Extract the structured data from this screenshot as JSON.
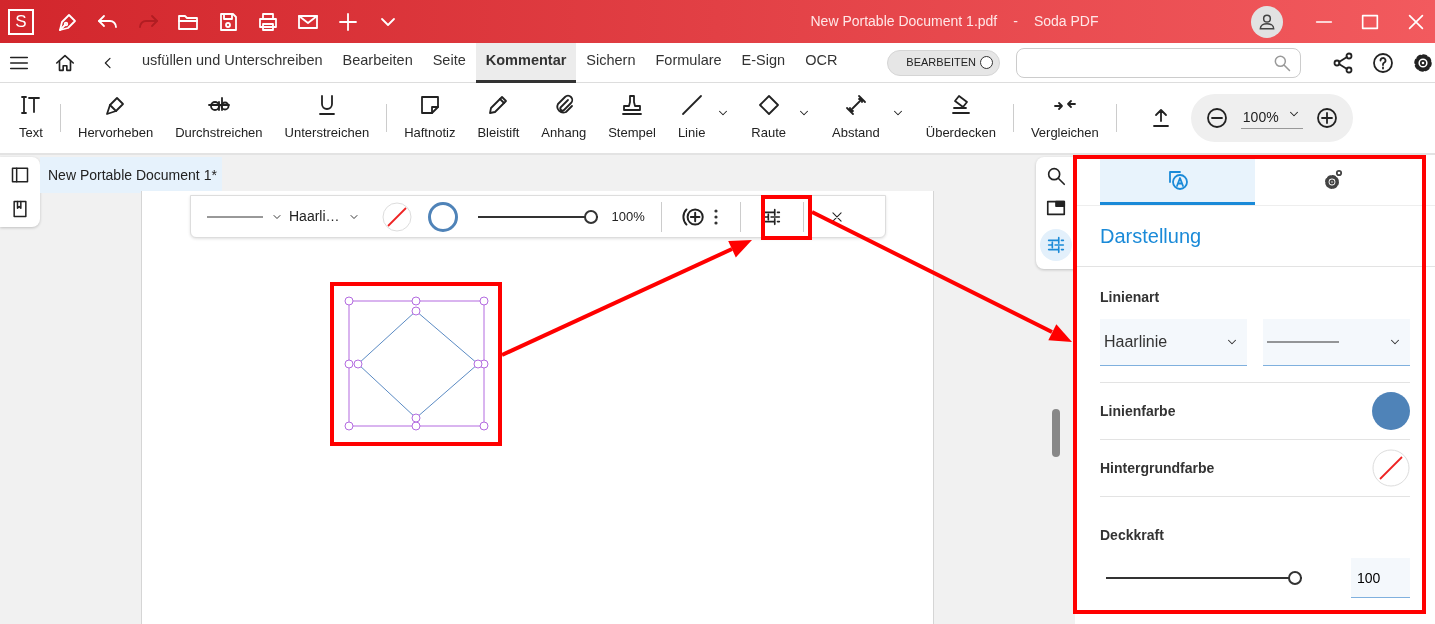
{
  "title_bar": {
    "logo": "S",
    "quick_actions": [
      {
        "disabled": false
      },
      {
        "disabled": false
      },
      {
        "disabled": true
      },
      {
        "disabled": false
      },
      {
        "disabled": false
      },
      {
        "disabled": false
      },
      {
        "disabled": false
      },
      {
        "disabled": false
      },
      {
        "disabled": false
      }
    ],
    "document": "New Portable Document 1.pdf",
    "separator": "-",
    "app": "Soda PDF"
  },
  "menu": {
    "tabs": [
      {
        "label": "usfüllen und Unterschreiben",
        "selected": false
      },
      {
        "label": "Bearbeiten",
        "selected": false
      },
      {
        "label": "Seite",
        "selected": false
      },
      {
        "label": "Kommentar",
        "selected": true
      },
      {
        "label": "Sichern",
        "selected": false
      },
      {
        "label": "Formulare",
        "selected": false
      },
      {
        "label": "E-Sign",
        "selected": false
      },
      {
        "label": "OCR",
        "selected": false
      }
    ],
    "edit_toggle": {
      "label": "BEARBEITEN",
      "on": false
    }
  },
  "toolbar": {
    "groups": [
      [
        {
          "label": "Text",
          "dropdown": false
        }
      ],
      [
        {
          "label": "Hervorheben",
          "dropdown": false
        },
        {
          "label": "Durchstreichen",
          "dropdown": false
        },
        {
          "label": "Unterstreichen",
          "dropdown": false
        }
      ],
      [
        {
          "label": "Haftnotiz",
          "dropdown": false
        },
        {
          "label": "Bleistift",
          "dropdown": false
        },
        {
          "label": "Anhang",
          "dropdown": false
        },
        {
          "label": "Stempel",
          "dropdown": false
        },
        {
          "label": "Linie",
          "dropdown": true
        },
        {
          "label": "Raute",
          "dropdown": true
        },
        {
          "label": "Abstand",
          "dropdown": true
        },
        {
          "label": "Überdecken",
          "dropdown": false
        }
      ],
      [
        {
          "label": "Vergleichen",
          "dropdown": false
        }
      ]
    ],
    "zoom": "100%"
  },
  "document_tab": "New Portable Document 1*",
  "annotation_toolbar": {
    "line_style": "Haarli…",
    "line_swatch": {
      "color": "#4f83b8"
    },
    "opacity_slider": {
      "level": 1
    },
    "opacity": "100%"
  },
  "panel": {
    "tabs": [
      {
        "selected": true
      },
      {
        "selected": false
      }
    ],
    "heading": "Darstellung",
    "line_type_label": "Linienart",
    "line_type": "Haarlinie",
    "line_color_label": "Linienfarbe",
    "line_swatch": {
      "color": "#4f83b8"
    },
    "background_label": "Hintergrundfarbe",
    "opacity_label": "Deckkraft",
    "opacity_slider": {
      "level": 1
    },
    "opacity": "100"
  }
}
